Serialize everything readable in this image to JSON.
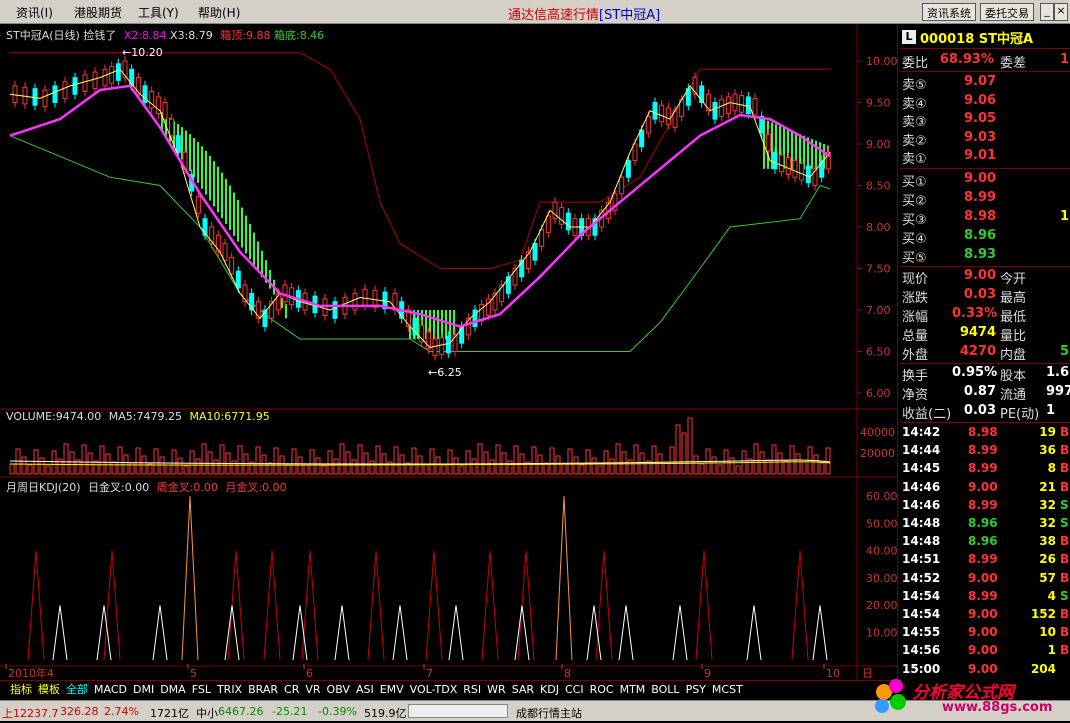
{
  "menu": {
    "items": [
      "资讯(I)",
      "港股期货",
      "工具(Y)",
      "帮助(H)"
    ],
    "title_main": "通达信高速行情",
    "title_stock": "[ST中冠A]",
    "btn_news": "资讯系统",
    "btn_trade": "委托交易",
    "win_min": "_",
    "win_max": "□",
    "win_close": "×"
  },
  "chart_header": {
    "name": "ST中冠A(日线)",
    "tip": "捡钱了",
    "x2": "X2:8.84",
    "x3": "X3:8.79",
    "top": "箱顶:9.88",
    "bottom": "箱底:8.46"
  },
  "vol_header": {
    "vol": "VOLUME:9474.00",
    "ma5": "MA5:7479.25",
    "ma10": "MA10:6771.95"
  },
  "kdj_header": {
    "name": "月周日KDJ(20)",
    "day": "日金叉:0.00",
    "week": "周金叉:0.00",
    "month": "月金叉:0.00"
  },
  "annotations": {
    "high": "10.20",
    "low": "6.25"
  },
  "price_axis": [
    "10.00",
    "9.50",
    "9.00",
    "8.50",
    "8.00",
    "7.50",
    "7.00",
    "6.50",
    "6.00"
  ],
  "vol_axis": [
    "40000",
    "20000"
  ],
  "kdj_axis": [
    "60.00",
    "50.00",
    "40.00",
    "30.00",
    "20.00",
    "10.00"
  ],
  "date_axis": [
    "2010年4",
    "5",
    "6",
    "7",
    "8",
    "9",
    "10"
  ],
  "date_axis_corner": "日",
  "tabs": [
    "指标",
    "模板",
    "全部",
    "MACD",
    "DMI",
    "DMA",
    "FSL",
    "TRIX",
    "BRAR",
    "CR",
    "VR",
    "OBV",
    "ASI",
    "EMV",
    "VOL-TDX",
    "RSI",
    "WR",
    "SAR",
    "KDJ",
    "CCI",
    "ROC",
    "MTM",
    "BOLL",
    "PSY",
    "MCST"
  ],
  "info": {
    "badge": "L",
    "code": "000018 ST中冠A",
    "wb_label": "委比",
    "wb_value": "68.93%",
    "wc_label": "委差",
    "wc_value": "1",
    "sells": [
      {
        "label": "卖⑤",
        "price": "9.07"
      },
      {
        "label": "卖④",
        "price": "9.06"
      },
      {
        "label": "卖③",
        "price": "9.05"
      },
      {
        "label": "卖②",
        "price": "9.03"
      },
      {
        "label": "卖①",
        "price": "9.01"
      }
    ],
    "buys": [
      {
        "label": "买①",
        "price": "9.00",
        "vol": ""
      },
      {
        "label": "买②",
        "price": "8.99",
        "vol": ""
      },
      {
        "label": "买③",
        "price": "8.98",
        "vol": "1"
      },
      {
        "label": "买④",
        "price": "8.96",
        "vol": ""
      },
      {
        "label": "买⑤",
        "price": "8.93",
        "vol": ""
      }
    ],
    "stats": [
      {
        "l": "现价",
        "v": "9.00",
        "vc": "#f33",
        "l2": "今开",
        "v2": ""
      },
      {
        "l": "涨跌",
        "v": "0.03",
        "vc": "#f33",
        "l2": "最高",
        "v2": ""
      },
      {
        "l": "涨幅",
        "v": "0.33%",
        "vc": "#f33",
        "l2": "最低",
        "v2": ""
      },
      {
        "l": "总量",
        "v": "9474",
        "vc": "#ff0",
        "l2": "量比",
        "v2": ""
      },
      {
        "l": "外盘",
        "v": "4270",
        "vc": "#f33",
        "l2": "内盘",
        "v2": "5"
      }
    ],
    "fund": [
      {
        "l": "换手",
        "v": "0.95%",
        "l2": "股本",
        "v2": "1.6"
      },
      {
        "l": "净资",
        "v": "0.87",
        "l2": "流通",
        "v2": "997"
      },
      {
        "l": "收益(二)",
        "v": "0.03",
        "l2": "PE(动)",
        "v2": "1"
      }
    ],
    "ticks": [
      {
        "t": "14:42",
        "p": "8.98",
        "pc": "#f33",
        "v": "19",
        "d": "B",
        "dc": "#f33"
      },
      {
        "t": "14:44",
        "p": "8.99",
        "pc": "#f33",
        "v": "36",
        "d": "B",
        "dc": "#f33"
      },
      {
        "t": "14:45",
        "p": "8.99",
        "pc": "#f33",
        "v": "8",
        "d": "B",
        "dc": "#f33"
      },
      {
        "t": "14:46",
        "p": "9.00",
        "pc": "#f33",
        "v": "21",
        "d": "B",
        "dc": "#f33"
      },
      {
        "t": "14:46",
        "p": "8.99",
        "pc": "#f33",
        "v": "32",
        "d": "S",
        "dc": "#3c3"
      },
      {
        "t": "14:48",
        "p": "8.96",
        "pc": "#3c3",
        "v": "32",
        "d": "S",
        "dc": "#3c3"
      },
      {
        "t": "14:48",
        "p": "8.96",
        "pc": "#3c3",
        "v": "38",
        "d": "B",
        "dc": "#f33"
      },
      {
        "t": "14:51",
        "p": "8.99",
        "pc": "#f33",
        "v": "26",
        "d": "B",
        "dc": "#f33"
      },
      {
        "t": "14:52",
        "p": "9.00",
        "pc": "#f33",
        "v": "57",
        "d": "B",
        "dc": "#f33"
      },
      {
        "t": "14:54",
        "p": "8.99",
        "pc": "#f33",
        "v": "4",
        "d": "S",
        "dc": "#3c3"
      },
      {
        "t": "14:54",
        "p": "9.00",
        "pc": "#f33",
        "v": "152",
        "d": "B",
        "dc": "#f33"
      },
      {
        "t": "14:55",
        "p": "9.00",
        "pc": "#f33",
        "v": "10",
        "d": "B",
        "dc": "#f33"
      },
      {
        "t": "14:56",
        "p": "9.00",
        "pc": "#f33",
        "v": "1",
        "d": "B",
        "dc": "#f33"
      },
      {
        "t": "15:00",
        "p": "9.00",
        "pc": "#f33",
        "v": "204",
        "d": "",
        "dc": "#f33"
      }
    ]
  },
  "status": {
    "sh": "上12237.7",
    "sh_chg": "326.28",
    "sh_pct": "2.74%",
    "sh_amt": "1721亿",
    "zx_label": "中小",
    "zx": "6467.26",
    "zx_chg": "-25.21",
    "zx_pct": "-0.39%",
    "zx_amt": "519.9亿",
    "site": "成都行情主站"
  },
  "watermark": {
    "brand": "分析家公式网",
    "url": "www.88gs.com"
  },
  "colors": {
    "up": "#ff3333",
    "down": "#00ffff",
    "ma_magenta": "#ff33ff",
    "box": "#b00000",
    "green": "#33cc33"
  }
}
